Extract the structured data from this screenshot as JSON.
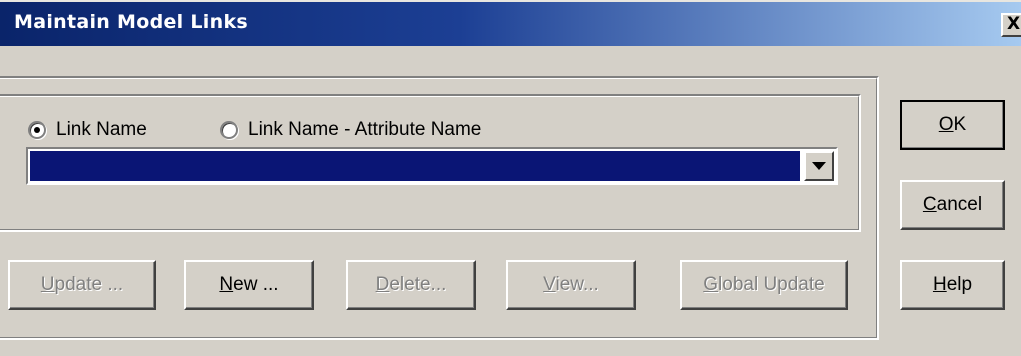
{
  "window": {
    "title": "Maintain Model Links",
    "close_glyph": "X"
  },
  "options": {
    "radio_link_name": {
      "label": "Link Name",
      "checked": true
    },
    "radio_link_attr": {
      "label": "Link Name - Attribute  Name",
      "checked": false
    }
  },
  "link_select": {
    "value": "",
    "icon": "chevron-down-icon"
  },
  "actions": {
    "update": {
      "mnemonic": "U",
      "rest": "pdate ...",
      "enabled": false
    },
    "new": {
      "mnemonic": "N",
      "rest": "ew ...",
      "enabled": true
    },
    "delete": {
      "mnemonic": "D",
      "rest": "elete...",
      "enabled": false
    },
    "view": {
      "mnemonic": "V",
      "rest": "iew...",
      "enabled": false
    },
    "global_update": {
      "mnemonic": "G",
      "rest": "lobal Update",
      "enabled": false
    }
  },
  "dialog_buttons": {
    "ok": {
      "mnemonic": "O",
      "rest": "K"
    },
    "cancel": {
      "mnemonic": "C",
      "rest": "ancel"
    },
    "help": {
      "mnemonic": "H",
      "rest": "elp"
    }
  },
  "colors": {
    "title_gradient_start": "#0a246a",
    "title_gradient_end": "#a6caf0",
    "selection": "#0a1575",
    "face": "#d4d0c8"
  }
}
